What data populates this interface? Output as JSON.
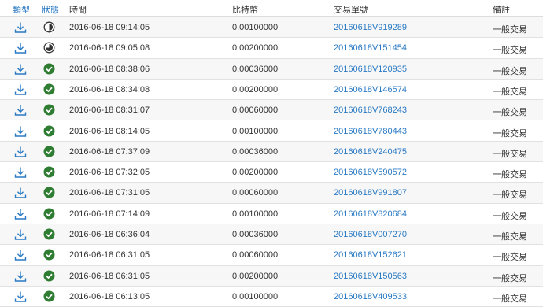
{
  "header": {
    "type": "類型",
    "status": "狀態",
    "time": "時間",
    "btc": "比特幣",
    "tx": "交易單號",
    "note": "備註"
  },
  "rows": [
    {
      "type_icon": "download-icon",
      "status_icon": "status-half-icon",
      "time": "2016-06-18 09:14:05",
      "btc": "0.00100000",
      "tx": "20160618V919289",
      "note": "一般交易"
    },
    {
      "type_icon": "download-icon",
      "status_icon": "status-partial-icon",
      "time": "2016-06-18 09:05:08",
      "btc": "0.00200000",
      "tx": "20160618V151454",
      "note": "一般交易"
    },
    {
      "type_icon": "download-icon",
      "status_icon": "check-icon",
      "time": "2016-06-18 08:38:06",
      "btc": "0.00036000",
      "tx": "20160618V120935",
      "note": "一般交易"
    },
    {
      "type_icon": "download-icon",
      "status_icon": "check-icon",
      "time": "2016-06-18 08:34:08",
      "btc": "0.00200000",
      "tx": "20160618V146574",
      "note": "一般交易"
    },
    {
      "type_icon": "download-icon",
      "status_icon": "check-icon",
      "time": "2016-06-18 08:31:07",
      "btc": "0.00060000",
      "tx": "20160618V768243",
      "note": "一般交易"
    },
    {
      "type_icon": "download-icon",
      "status_icon": "check-icon",
      "time": "2016-06-18 08:14:05",
      "btc": "0.00100000",
      "tx": "20160618V780443",
      "note": "一般交易"
    },
    {
      "type_icon": "download-icon",
      "status_icon": "check-icon",
      "time": "2016-06-18 07:37:09",
      "btc": "0.00036000",
      "tx": "20160618V240475",
      "note": "一般交易"
    },
    {
      "type_icon": "download-icon",
      "status_icon": "check-icon",
      "time": "2016-06-18 07:32:05",
      "btc": "0.00200000",
      "tx": "20160618V590572",
      "note": "一般交易"
    },
    {
      "type_icon": "download-icon",
      "status_icon": "check-icon",
      "time": "2016-06-18 07:31:05",
      "btc": "0.00060000",
      "tx": "20160618V991807",
      "note": "一般交易"
    },
    {
      "type_icon": "download-icon",
      "status_icon": "check-icon",
      "time": "2016-06-18 07:14:09",
      "btc": "0.00100000",
      "tx": "20160618V820684",
      "note": "一般交易"
    },
    {
      "type_icon": "download-icon",
      "status_icon": "check-icon",
      "time": "2016-06-18 06:36:04",
      "btc": "0.00036000",
      "tx": "20160618V007270",
      "note": "一般交易"
    },
    {
      "type_icon": "download-icon",
      "status_icon": "check-icon",
      "time": "2016-06-18 06:31:05",
      "btc": "0.00060000",
      "tx": "20160618V152621",
      "note": "一般交易"
    },
    {
      "type_icon": "download-icon",
      "status_icon": "check-icon",
      "time": "2016-06-18 06:31:05",
      "btc": "0.00200000",
      "tx": "20160618V150563",
      "note": "一般交易"
    },
    {
      "type_icon": "download-icon",
      "status_icon": "check-icon",
      "time": "2016-06-18 06:13:05",
      "btc": "0.00100000",
      "tx": "20160618V409533",
      "note": "一般交易"
    }
  ],
  "colors": {
    "link": "#2a7ac3",
    "success": "#2e7d32",
    "stripe": "#f7f7f7"
  }
}
